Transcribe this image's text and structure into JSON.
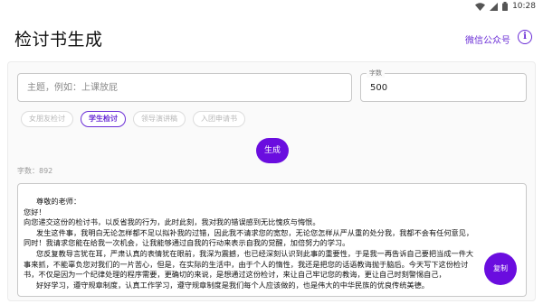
{
  "status_bar": {
    "time": "10:28",
    "icons": [
      "wifi-icon",
      "cell-signal-icon",
      "battery-icon"
    ]
  },
  "app_bar": {
    "title": "检讨书生成",
    "wechat_label": "微信公众号",
    "info_icon": "info-icon"
  },
  "form": {
    "theme_placeholder": "主题，例如：上课放屁",
    "theme_value": "",
    "word_count_label": "字数",
    "word_count_value": "500"
  },
  "templates": [
    {
      "label": "女朋友检讨",
      "selected": false
    },
    {
      "label": "学生检讨",
      "selected": true
    },
    {
      "label": "领导演讲稿",
      "selected": false
    },
    {
      "label": "入团申请书",
      "selected": false
    }
  ],
  "generate_label": "生成",
  "char_count_text": "字数：892",
  "output": {
    "salutation": "尊敬的老师：",
    "greeting": "您好！",
    "lines": [
      "向您递交这份的检讨书，以反省我的行为，此时此刻，我对我的错误感到无比愧疚与悔恨。",
      "发生这件事，我明白无论怎样都不足以拟补我的过错，因此我不请求您的宽恕，无论您怎样从严从重的处分我，我都不会有任何意见，",
      "同时！我请求您能在给我一次机会，让我能够通过自我的行动来表示自我的觉醒，加倍努力的学习。",
      "您反复教导言犹在耳，严肃认真的表情犹在眼前，我深为震撼，也已经深刻认识到此事的重要性，于是我一再告诉自己要把当成一件大",
      "事来抓，不能辜负您对我们的一片苦心，但是，在实际的生活中，由于个人的惰性，我还是把您的话语教诲抛于脑后。今天写下这份检讨",
      "书，不仅是因为一个纪律处理的程序需要，更确切的来说，是想通过这份检讨，来让自己牢记您的教诲，更让自己时刻警惕自己，",
      "好好学习，遵守规章制度，认真工作学习，遵守规章制度是我们每个人应该做的，也是伟大的中华民族的优良传统美德。"
    ]
  },
  "copy_label": "复制",
  "colors": {
    "accent": "#6a0ddf",
    "accent_text": "#6a2dd6"
  }
}
